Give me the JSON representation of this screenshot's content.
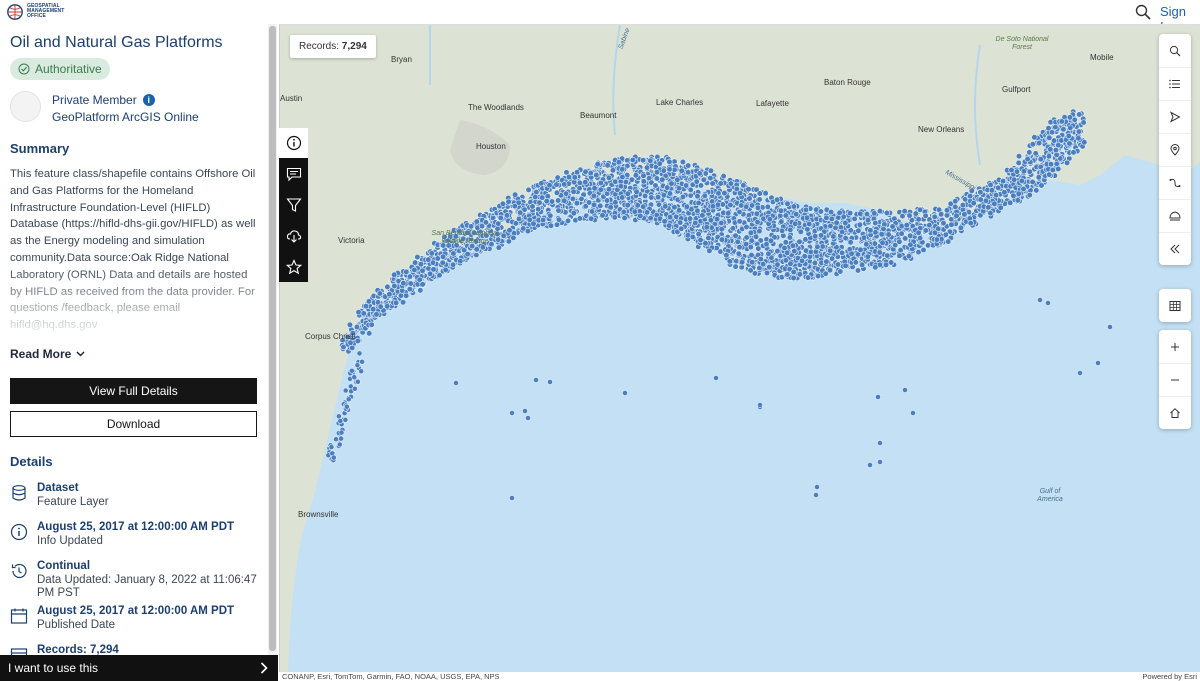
{
  "header": {
    "logo_text": [
      "GEOSPATIAL",
      "MANAGEMENT",
      "OFFICE"
    ],
    "signin_label": "Sign In"
  },
  "item": {
    "title": "Oil and Natural Gas Platforms",
    "badge": "Authoritative",
    "owner": "Private Member",
    "org": "GeoPlatform ArcGIS Online"
  },
  "summary": {
    "heading": "Summary",
    "text": "This feature class/shapefile contains Offshore Oil and Gas Platforms for the Homeland Infrastructure Foundation-Level (HIFLD) Database (https://hifld-dhs-gii.gov/HIFLD) as well as the Energy modeling and simulation community.Data source:Oak Ridge National Laboratory (ORNL) Data and details are hosted by HIFLD as received from the data provider. For questions /feedback, please email hifld@hq.dhs.gov",
    "read_more": "Read More"
  },
  "buttons": {
    "view_full": "View Full Details",
    "download": "Download"
  },
  "details": {
    "heading": "Details",
    "rows": [
      {
        "title": "Dataset",
        "sub": "Feature Layer",
        "icon": "database-icon"
      },
      {
        "title": "August 25, 2017 at 12:00:00 AM PDT",
        "sub": "Info Updated",
        "icon": "info-icon"
      },
      {
        "title": "Continual",
        "sub": "Data Updated: January 8, 2022 at 11:06:47 PM PST",
        "icon": "history-icon"
      },
      {
        "title": "August 25, 2017 at 12:00:00 AM PDT",
        "sub": "Published Date",
        "icon": "calendar-icon"
      },
      {
        "title": "Records: 7,294",
        "sub": "",
        "icon": "table-icon"
      }
    ]
  },
  "footer_bar": {
    "label": "I want to use this"
  },
  "map": {
    "records_label": "Records:",
    "records_value": "7,294",
    "water_color": "#c3e0f4",
    "land_color": "#dde3d4",
    "point_color": "#4a7fbf",
    "cities": [
      {
        "name": "Bryan"
      },
      {
        "name": "Austin"
      },
      {
        "name": "The Woodlands"
      },
      {
        "name": "Beaumont"
      },
      {
        "name": "Lake Charles"
      },
      {
        "name": "Lafayette"
      },
      {
        "name": "Baton Rouge"
      },
      {
        "name": "Gulfport"
      },
      {
        "name": "Mobile"
      },
      {
        "name": "New Orleans"
      },
      {
        "name": "Houston"
      },
      {
        "name": "Victoria"
      },
      {
        "name": "Corpus Christi"
      },
      {
        "name": "Brownsville"
      }
    ],
    "labels": {
      "san_bernard": "San Bernard National Wildlife Refuge",
      "desoto": "De Soto National Forest",
      "gulf": "Gulf of America",
      "sabine": "Sabine",
      "mississippi": "Mississippi"
    },
    "attribution_left": "CONANP, Esri, TomTom, Garmin, FAO, NOAA, USGS, EPA, NPS",
    "attribution_right": "Powered by Esri"
  },
  "tools": {
    "left": [
      "info-icon",
      "comment-icon",
      "filter-icon",
      "cloud-download-icon",
      "star-icon"
    ],
    "right_top": [
      "search-icon",
      "legend-icon",
      "navigate-icon",
      "pin-icon",
      "measure-icon",
      "basemap-icon",
      "collapse-icon"
    ],
    "right_mid": [
      "table-icon"
    ],
    "right_bottom": [
      "zoom-in-icon",
      "zoom-out-icon",
      "home-icon"
    ]
  }
}
